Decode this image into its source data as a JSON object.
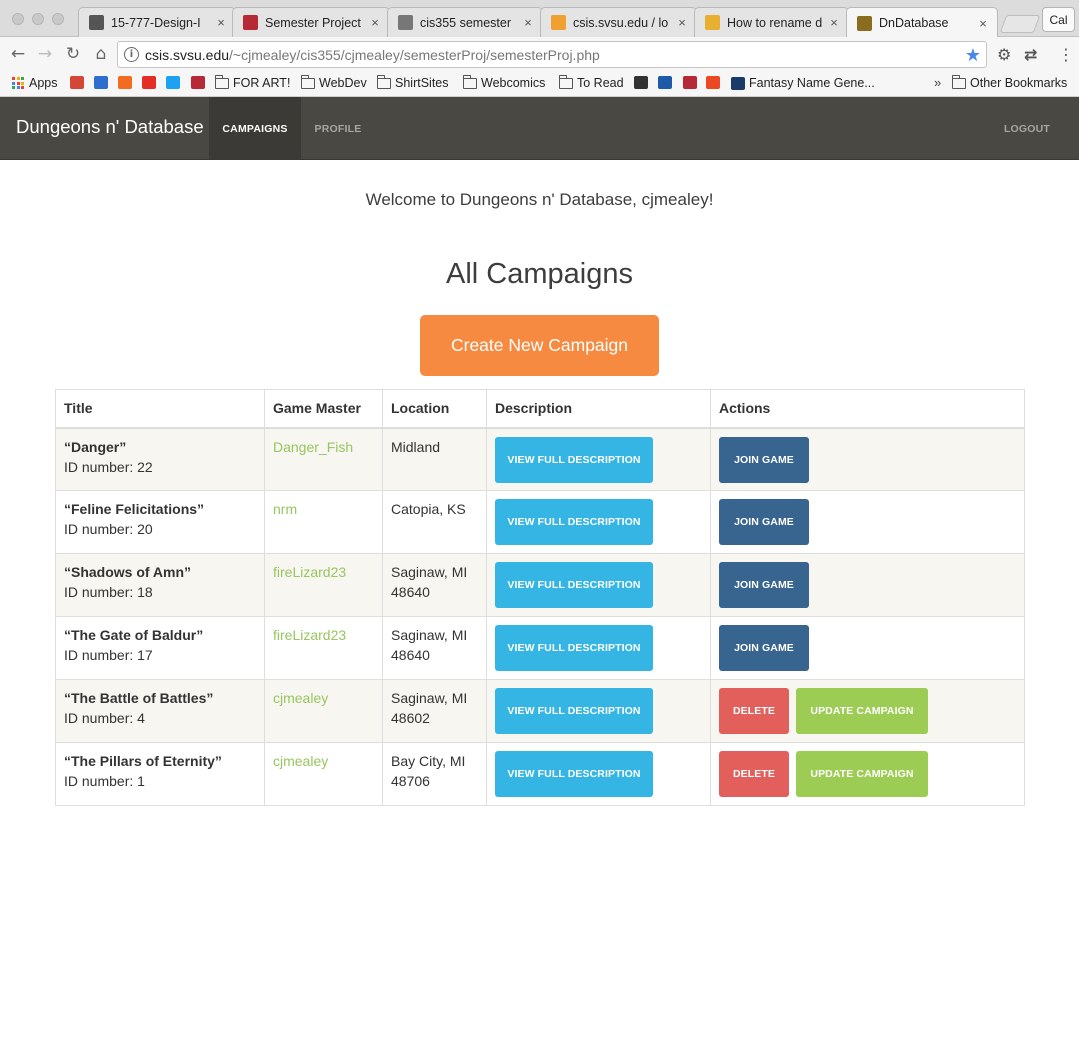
{
  "browser": {
    "tabs": [
      {
        "label": "15-777-Design-I",
        "favicon": "building-icon",
        "color": "#555555",
        "active": false
      },
      {
        "label": "Semester Project",
        "favicon": "svsu-icon",
        "color": "#b52a34",
        "active": false
      },
      {
        "label": "cis355 semester",
        "favicon": "page-icon",
        "color": "#777777",
        "active": false
      },
      {
        "label": "csis.svsu.edu / lo",
        "favicon": "pma-icon",
        "color": "#f0a030",
        "active": false
      },
      {
        "label": "How to rename d",
        "favicon": "figure-icon",
        "color": "#e8b030",
        "active": false
      },
      {
        "label": "DnDatabase",
        "favicon": "dnd-icon",
        "color": "#8a6d1e",
        "active": true
      }
    ],
    "profile_label": "Cal",
    "url_host": "csis.svsu.edu",
    "url_path": "/~cjmealey/cis355/cjmealey/semesterProj/semesterProj.php",
    "bookmarks": [
      {
        "label": "Apps",
        "icon": "apps-grid-icon"
      },
      {
        "label": "",
        "icon": "gmail-icon",
        "color": "#d44638"
      },
      {
        "label": "",
        "icon": "mail-icon",
        "color": "#2c6fce"
      },
      {
        "label": "",
        "icon": "music-icon",
        "color": "#f26b21"
      },
      {
        "label": "",
        "icon": "youtube-icon",
        "color": "#e52d27"
      },
      {
        "label": "",
        "icon": "twitter-icon",
        "color": "#1da1f2"
      },
      {
        "label": "",
        "icon": "svsu-icon",
        "color": "#b52a34"
      },
      {
        "label": "FOR ART!",
        "icon": "folder-icon"
      },
      {
        "label": "WebDev",
        "icon": "folder-icon"
      },
      {
        "label": "ShirtSites",
        "icon": "folder-icon"
      },
      {
        "label": "Webcomics",
        "icon": "folder-icon"
      },
      {
        "label": "To Read",
        "icon": "folder-icon"
      },
      {
        "label": "",
        "icon": "c-icon",
        "color": "#333333"
      },
      {
        "label": "",
        "icon": "globe-icon",
        "color": "#1e5aa8"
      },
      {
        "label": "",
        "icon": "svsu-icon",
        "color": "#b52a34"
      },
      {
        "label": "",
        "icon": "stumble-icon",
        "color": "#eb4924"
      },
      {
        "label": "Fantasy Name Gene...",
        "icon": "r-icon",
        "color": "#1a3a6a"
      },
      {
        "label": "Other Bookmarks",
        "icon": "folder-icon"
      }
    ],
    "overflow_label": "»"
  },
  "app": {
    "brand": "Dungeons n' Database",
    "nav": {
      "campaigns": "CAMPAIGNS",
      "profile": "PROFILE",
      "logout": "LOGOUT"
    },
    "welcome": "Welcome to Dungeons n' Database, cjmealey!",
    "heading": "All Campaigns",
    "create_button": "Create New Campaign",
    "table": {
      "headers": {
        "title": "Title",
        "game_master": "Game Master",
        "location": "Location",
        "description": "Description",
        "actions": "Actions"
      },
      "id_prefix": "ID number:",
      "button_labels": {
        "view": "VIEW FULL DESCRIPTION",
        "join": "JOIN GAME",
        "delete": "DELETE",
        "update": "UPDATE CAMPAIGN"
      },
      "rows": [
        {
          "title": "“Danger”",
          "id": "22",
          "game_master": "Danger_Fish",
          "location_line1": "Midland",
          "location_line2": "",
          "owner": false
        },
        {
          "title": "“Feline Felicitations”",
          "id": "20",
          "game_master": "nrm",
          "location_line1": "Catopia, KS",
          "location_line2": "",
          "owner": false
        },
        {
          "title": "“Shadows of Amn”",
          "id": "18",
          "game_master": "fireLizard23",
          "location_line1": "Saginaw, MI",
          "location_line2": "48640",
          "owner": false
        },
        {
          "title": "“The Gate of Baldur”",
          "id": "17",
          "game_master": "fireLizard23",
          "location_line1": "Saginaw, MI",
          "location_line2": "48640",
          "owner": false
        },
        {
          "title": "“The Battle of Battles”",
          "id": "4",
          "game_master": "cjmealey",
          "location_line1": "Saginaw, MI",
          "location_line2": "48602",
          "owner": true
        },
        {
          "title": "“The Pillars of Eternity”",
          "id": "1",
          "game_master": "cjmealey",
          "location_line1": "Bay City, MI",
          "location_line2": "48706",
          "owner": true
        }
      ]
    }
  }
}
